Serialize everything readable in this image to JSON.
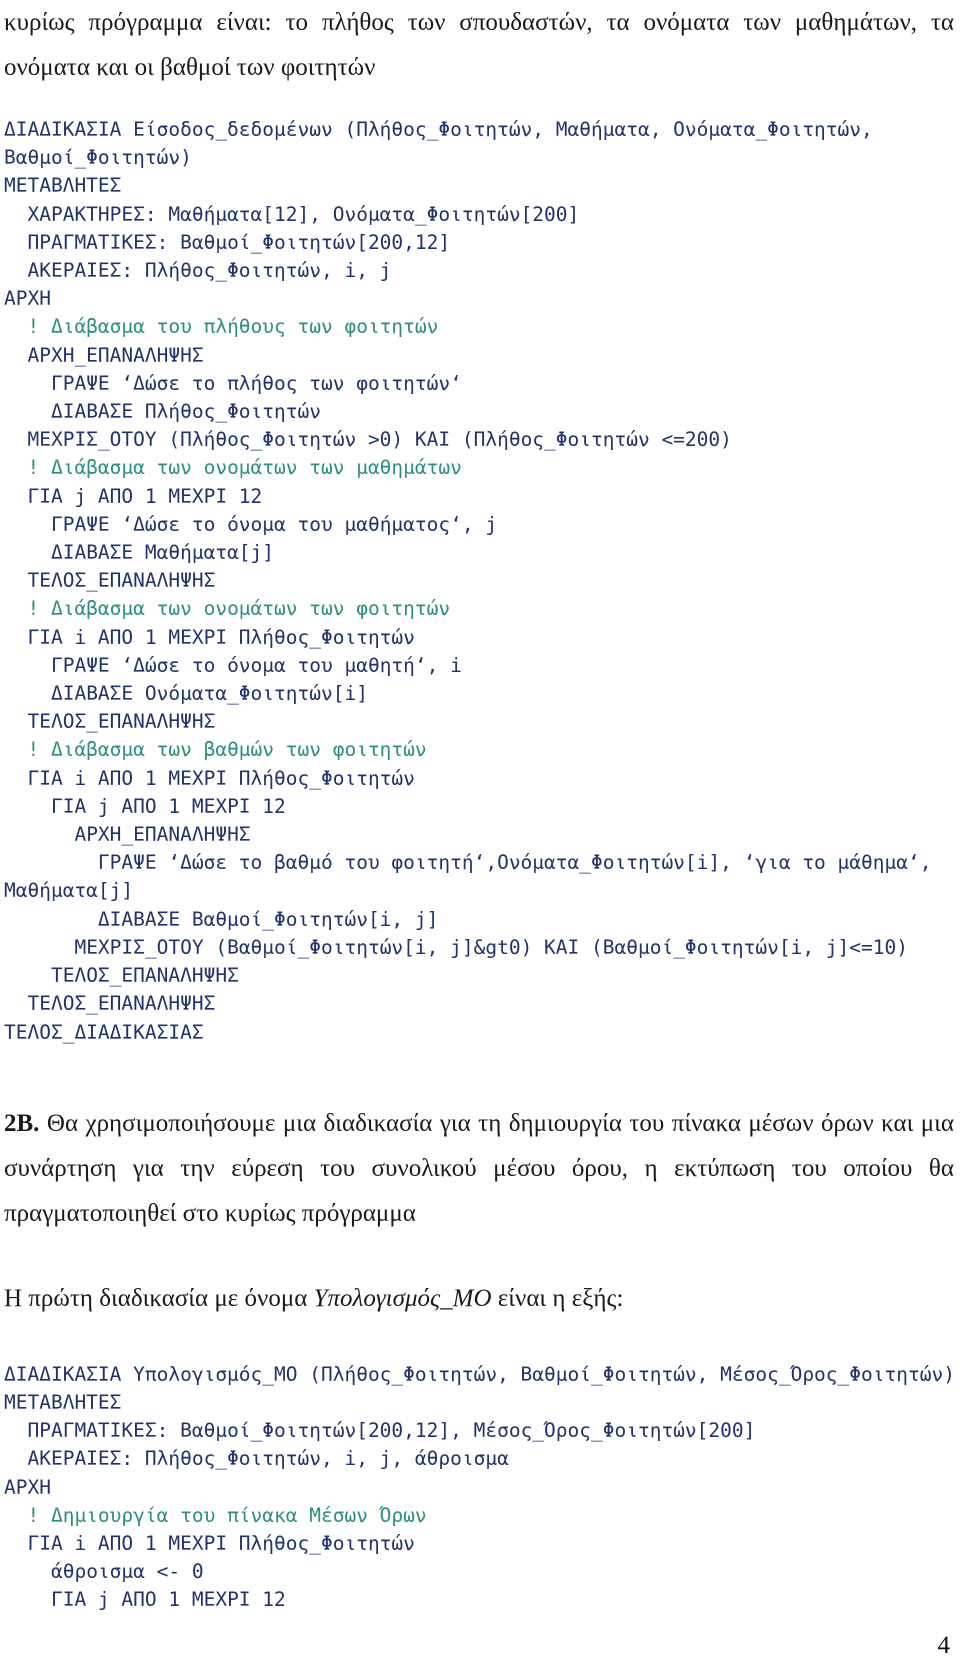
{
  "document": {
    "page_number": "4",
    "colors": {
      "code": "#22336b",
      "comment": "#2f8f7f",
      "body_text": "#1a1a1a",
      "background": "#ffffff"
    }
  },
  "intro": {
    "paragraph_1": "κυρίως πρόγραμμα είναι: το πλήθος των σπουδαστών, τα ονόματα των μαθημάτων, τα ονόματα και οι βαθμοί των φοιτητών"
  },
  "code_block_1": {
    "name": "Είσοδος_δεδομένων",
    "lines": [
      {
        "text": "ΔΙΑΔΙΚΑΣΙΑ Είσοδος_δεδομένων (Πλήθος_Φοιτητών, Μαθήματα, Ονόματα_Φοιτητών, Βαθμοί_Φοιτητών)",
        "type": "code"
      },
      {
        "text": "ΜΕΤΑΒΛΗΤΕΣ",
        "type": "code"
      },
      {
        "text": "  ΧΑΡΑΚΤΗΡΕΣ: Μαθήματα[12], Ονόματα_Φοιτητών[200]",
        "type": "code"
      },
      {
        "text": "  ΠΡΑΓΜΑΤΙΚΕΣ: Βαθμοί_Φοιτητών[200,12]",
        "type": "code"
      },
      {
        "text": "  ΑΚΕΡΑΙΕΣ: Πλήθος_Φοιτητών, i, j",
        "type": "code"
      },
      {
        "text": "ΑΡΧΗ",
        "type": "code"
      },
      {
        "text": "  ! Διάβασμα του πλήθους των φοιτητών",
        "type": "comment"
      },
      {
        "text": "  ΑΡΧΗ_ΕΠΑΝΑΛΗΨΗΣ",
        "type": "code"
      },
      {
        "text": "    ΓΡΑΨΕ ‘Δώσε το πλήθος των φοιτητών‘",
        "type": "code"
      },
      {
        "text": "    ΔΙΑΒΑΣΕ Πλήθος_Φοιτητών",
        "type": "code"
      },
      {
        "text": "  ΜΕΧΡΙΣ_ΟΤΟΥ (Πλήθος_Φοιτητών >0) ΚΑΙ (Πλήθος_Φοιτητών <=200)",
        "type": "code"
      },
      {
        "text": "  ! Διάβασμα των ονομάτων των μαθημάτων",
        "type": "comment"
      },
      {
        "text": "  ΓΙΑ j ΑΠΟ 1 ΜΕΧΡΙ 12",
        "type": "code"
      },
      {
        "text": "    ΓΡΑΨΕ ‘Δώσε το όνομα του μαθήματος‘, j",
        "type": "code"
      },
      {
        "text": "    ΔΙΑΒΑΣΕ Μαθήματα[j]",
        "type": "code"
      },
      {
        "text": "  ΤΕΛΟΣ_ΕΠΑΝΑΛΗΨΗΣ",
        "type": "code"
      },
      {
        "text": "  ! Διάβασμα των ονομάτων των φοιτητών",
        "type": "comment"
      },
      {
        "text": "  ΓΙΑ i ΑΠΟ 1 ΜΕΧΡΙ Πλήθος_Φοιτητών",
        "type": "code"
      },
      {
        "text": "    ΓΡΑΨΕ ‘Δώσε το όνομα του μαθητή‘, i",
        "type": "code"
      },
      {
        "text": "    ΔΙΑΒΑΣΕ Ονόματα_Φοιτητών[i]",
        "type": "code"
      },
      {
        "text": "  ΤΕΛΟΣ_ΕΠΑΝΑΛΗΨΗΣ",
        "type": "code"
      },
      {
        "text": "  ! Διάβασμα των βαθμών των φοιτητών",
        "type": "comment"
      },
      {
        "text": "  ΓΙΑ i ΑΠΟ 1 ΜΕΧΡΙ Πλήθος_Φοιτητών",
        "type": "code"
      },
      {
        "text": "    ΓΙΑ j ΑΠΟ 1 ΜΕΧΡΙ 12",
        "type": "code"
      },
      {
        "text": "      ΑΡΧΗ_ΕΠΑΝΑΛΗΨΗΣ",
        "type": "code"
      },
      {
        "text": "        ΓΡΑΨΕ ‘Δώσε το βαθμό του φοιτητή‘,Ονόματα_Φοιτητών[i], ‘για το μάθημα‘, Μαθήματα[j]",
        "type": "code"
      },
      {
        "text": "        ΔΙΑΒΑΣΕ Βαθμοί_Φοιτητών[i, j]",
        "type": "code"
      },
      {
        "text": "      ΜΕΧΡΙΣ_ΟΤΟΥ (Βαθμοί_Φοιτητών[i, j]&gt0) ΚΑΙ (Βαθμοί_Φοιτητών[i, j]<=10)",
        "type": "code"
      },
      {
        "text": "    ΤΕΛΟΣ_ΕΠΑΝΑΛΗΨΗΣ",
        "type": "code"
      },
      {
        "text": "  ΤΕΛΟΣ_ΕΠΑΝΑΛΗΨΗΣ",
        "type": "code"
      },
      {
        "text": "ΤΕΛΟΣ_ΔΙΑΔΙΚΑΣΙΑΣ",
        "type": "code"
      }
    ]
  },
  "section_2b": {
    "label": "2B.",
    "paragraph": "Θα χρησιμοποιήσουμε μια διαδικασία για τη δημιουργία του πίνακα μέσων όρων και μια συνάρτηση για την εύρεση του συνολικού μέσου όρου, η εκτύπωση του οποίου θα πραγματοποιηθεί στο κυρίως πρόγραμμα"
  },
  "intro_procedure": {
    "text_before": "Η πρώτη διαδικασία με όνομα ",
    "procedure_name": "Υπολογισμός_ΜΟ",
    "text_after": " είναι η εξής:"
  },
  "code_block_2": {
    "name": "Υπολογισμός_ΜΟ",
    "lines": [
      {
        "text": "ΔΙΑΔΙΚΑΣΙΑ Υπολογισμός_ΜΟ (Πλήθος_Φοιτητών, Βαθμοί_Φοιτητών, Μέσος_Όρος_Φοιτητών)",
        "type": "code"
      },
      {
        "text": "ΜΕΤΑΒΛΗΤΕΣ",
        "type": "code"
      },
      {
        "text": "  ΠΡΑΓΜΑΤΙΚΕΣ: Βαθμοί_Φοιτητών[200,12], Μέσος_Όρος_Φοιτητών[200]",
        "type": "code"
      },
      {
        "text": "  ΑΚΕΡΑΙΕΣ: Πλήθος_Φοιτητών, i, j, άθροισμα",
        "type": "code"
      },
      {
        "text": "ΑΡΧΗ",
        "type": "code"
      },
      {
        "text": "  ! Δημιουργία του πίνακα Μέσων Όρων",
        "type": "comment"
      },
      {
        "text": "  ΓΙΑ i ΑΠΟ 1 ΜΕΧΡΙ Πλήθος_Φοιτητών",
        "type": "code"
      },
      {
        "text": "    άθροισμα <- 0",
        "type": "code"
      },
      {
        "text": "    ΓΙΑ j ΑΠΟ 1 ΜΕΧΡΙ 12",
        "type": "code"
      }
    ]
  }
}
